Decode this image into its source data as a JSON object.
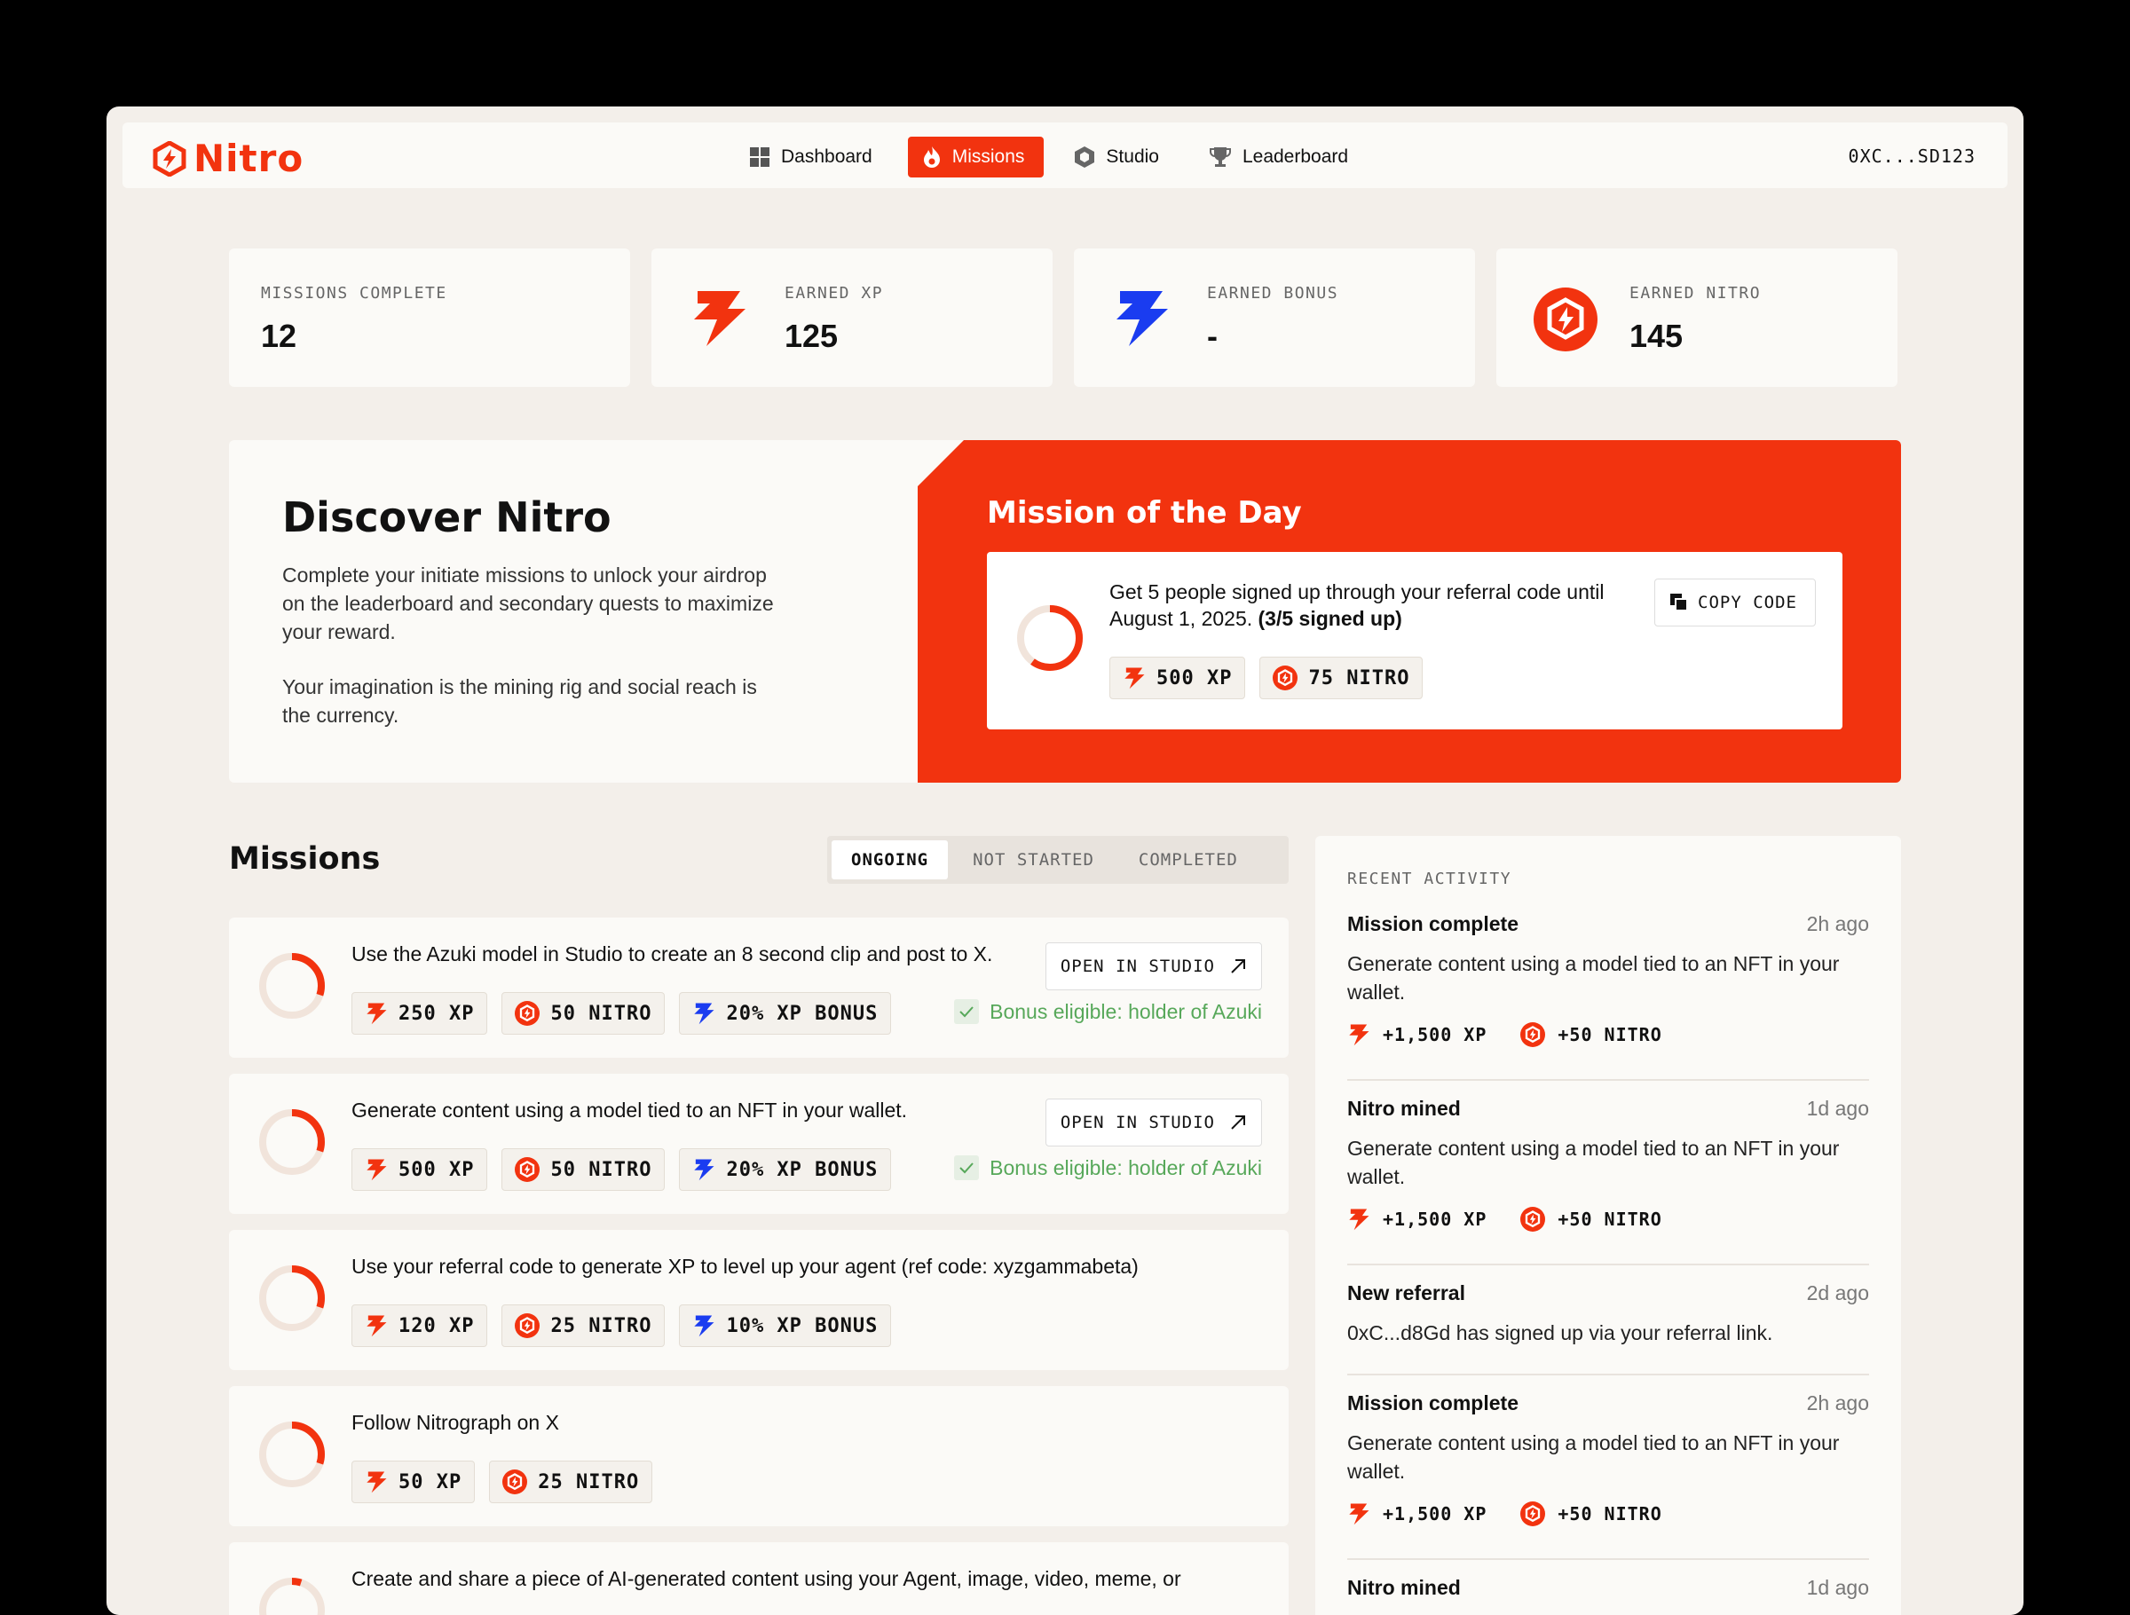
{
  "nav": {
    "logo": "Nitro",
    "items": [
      {
        "label": "Dashboard",
        "icon": "grid-icon"
      },
      {
        "label": "Missions",
        "icon": "flame-icon",
        "active": true
      },
      {
        "label": "Studio",
        "icon": "hexagon-icon"
      },
      {
        "label": "Leaderboard",
        "icon": "trophy-icon"
      }
    ],
    "wallet": "0XC...SD123"
  },
  "stats": [
    {
      "label": "MISSIONS COMPLETE",
      "value": "12"
    },
    {
      "label": "EARNED XP",
      "value": "125",
      "icon": "xp-bolt-icon"
    },
    {
      "label": "EARNED BONUS",
      "value": "-",
      "icon": "bonus-bolt-icon"
    },
    {
      "label": "EARNED NITRO",
      "value": "145",
      "icon": "nitro-coin-icon"
    }
  ],
  "discover": {
    "title": "Discover Nitro",
    "p1": "Complete your initiate missions to unlock your airdrop on the leaderboard and secondary quests to maximize your reward.",
    "p2": "Your imagination is the mining rig and social reach is the currency."
  },
  "motd": {
    "title": "Mission of the Day",
    "text": "Get 5 people signed up through your referral code until August 1, 2025.",
    "progress_text": "(3/5 signed up)",
    "progress": 0.6,
    "copy_label": "COPY CODE",
    "xp": "500 XP",
    "nitro": "75 NITRO"
  },
  "missions": {
    "title": "Missions",
    "tabs": [
      "ONGOING",
      "NOT STARTED",
      "COMPLETED"
    ],
    "items": [
      {
        "title": "Use the Azuki model in Studio to create an 8 second clip and post to X.",
        "xp": "250 XP",
        "nitro": "50 NITRO",
        "bonus": "20% XP BONUS",
        "button": "OPEN IN STUDIO",
        "eligible": "Bonus eligible: holder of Azuki",
        "progress": 0.3
      },
      {
        "title": "Generate content using a model tied to an NFT in your wallet.",
        "xp": "500 XP",
        "nitro": "50 NITRO",
        "bonus": "20% XP BONUS",
        "button": "OPEN IN STUDIO",
        "eligible": "Bonus eligible: holder of Azuki",
        "progress": 0.3
      },
      {
        "title": "Use your referral code to generate XP to level up your agent (ref code: xyzgammabeta)",
        "xp": "120 XP",
        "nitro": "25 NITRO",
        "bonus": "10% XP BONUS",
        "progress": 0.3
      },
      {
        "title": "Follow Nitrograph on X",
        "xp": "50 XP",
        "nitro": "25 NITRO",
        "progress": 0.3
      },
      {
        "title": "Create and share a piece of AI-generated content using your Agent, image, video, meme, or",
        "progress": 0.05
      }
    ]
  },
  "activity": {
    "heading": "RECENT ACTIVITY",
    "items": [
      {
        "title": "Mission complete",
        "time": "2h ago",
        "desc": "Generate content using a model tied to an NFT in your wallet.",
        "xp": "+1,500 XP",
        "nitro": "+50 NITRO"
      },
      {
        "title": "Nitro mined",
        "time": "1d ago",
        "desc": "Generate content using a model tied to an NFT in your wallet.",
        "xp": "+1,500 XP",
        "nitro": "+50 NITRO"
      },
      {
        "title": "New referral",
        "time": "2d ago",
        "desc": "0xC...d8Gd has signed up via your referral link."
      },
      {
        "title": "Mission complete",
        "time": "2h ago",
        "desc": "Generate content using a model tied to an NFT in your wallet.",
        "xp": "+1,500 XP",
        "nitro": "+50 NITRO"
      },
      {
        "title": "Nitro mined",
        "time": "1d ago"
      }
    ]
  },
  "colors": {
    "accent": "#f2330f",
    "bonus": "#1a3cf0",
    "success": "#57a85a"
  }
}
